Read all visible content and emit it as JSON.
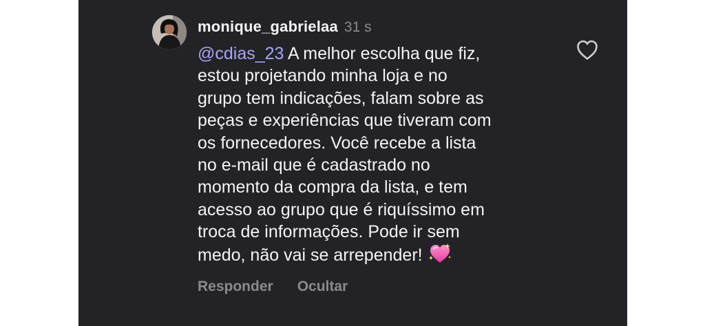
{
  "comment": {
    "username": "monique_gabrielaa",
    "timestamp": "31 s",
    "mention": "@cdias_23",
    "lines": [
      " A melhor escolha que fiz,",
      "estou projetando minha loja e no",
      "grupo tem indicações, falam sobre as",
      "peças e experiências que tiveram com",
      "os fornecedores. Você recebe a lista",
      "no e-mail que é cadastrado no",
      "momento da compra da lista, e tem",
      "acesso ao grupo que é riquíssimo em",
      "troca de informações. Pode ir sem",
      "medo, não vai se arrepender!"
    ],
    "emoji": "sparkling-heart-emoji"
  },
  "actions": {
    "reply_label": "Responder",
    "hide_label": "Ocultar"
  },
  "icons": {
    "like": "heart-outline-icon"
  },
  "colors": {
    "background": "#232327",
    "text": "#f4f4f4",
    "secondary_text": "#8b8b8f",
    "mention": "#a8a4f7"
  }
}
